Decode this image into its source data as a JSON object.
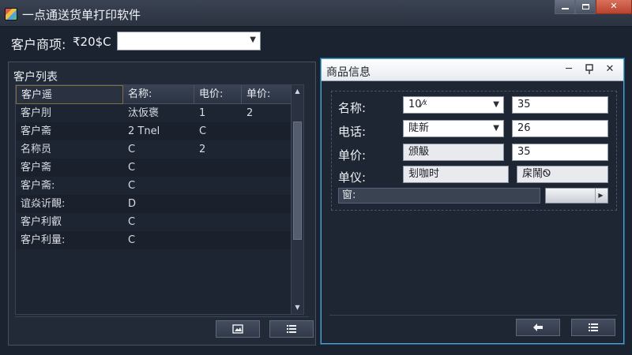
{
  "window": {
    "title": "一点通送货单打印软件",
    "controls": {
      "minimize": "minimize-icon",
      "maximize": "maximize-icon",
      "close": "close-icon"
    },
    "close_color": "#c9553f"
  },
  "filter": {
    "label": "客户商项:",
    "code": "₹20$C",
    "value": ""
  },
  "customer_list": {
    "title": "客户列表",
    "columns": [
      "客户遥",
      "名称:",
      "电价:",
      "单价:"
    ],
    "rows": [
      [
        "客户刖",
        "汰仮褒",
        "1",
        "2"
      ],
      [
        "客户斋",
        "2 Tnel",
        "C",
        ""
      ],
      [
        "名称员",
        "C",
        "2",
        ""
      ],
      [
        "客户斋",
        "C",
        "",
        ""
      ],
      [
        "客户斋:",
        "C",
        "",
        ""
      ],
      [
        "谊焱䜣靦:",
        "D",
        "",
        ""
      ],
      [
        "客户利叡",
        "C",
        "",
        ""
      ],
      [
        "客户利量:",
        "C",
        "",
        ""
      ]
    ],
    "footer_buttons": [
      "picture-icon",
      "list-icon"
    ]
  },
  "product_info": {
    "title": "商品信息",
    "header_controls": [
      "minimize-icon",
      "pin-icon",
      "close-icon"
    ],
    "fields": [
      {
        "label": "名称:",
        "value": "10⁄ᵡ",
        "extra": "35"
      },
      {
        "label": "电话:",
        "value": "陡新",
        "extra": "26"
      },
      {
        "label": "单价:",
        "value": "颁觙",
        "extra": "35"
      },
      {
        "label": "单仪:",
        "value": "刬咖时",
        "extra": "㦿鬧Ꮻ"
      }
    ],
    "path_label": "窗:",
    "footer_buttons": [
      "back-arrow-icon",
      "list-icon"
    ],
    "accent": "#4fa3d6"
  }
}
